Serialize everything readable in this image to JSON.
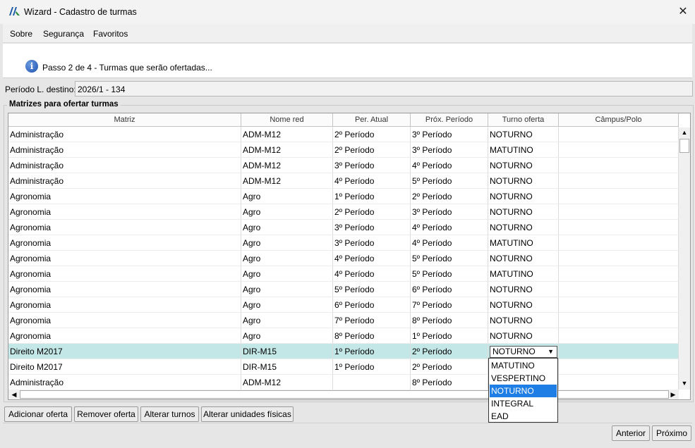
{
  "window": {
    "title": "Wizard - Cadastro de turmas",
    "close_glyph": "✕"
  },
  "menu": [
    {
      "label": "Sobre"
    },
    {
      "label": "Segurança"
    },
    {
      "label": "Favoritos"
    }
  ],
  "header": {
    "step_text": "Passo 2 de 4 - Turmas que serão ofertadas..."
  },
  "periodo": {
    "label": "Período L. destino:",
    "value": "2026/1 - 134"
  },
  "group": {
    "title": "Matrizes para ofertar turmas"
  },
  "table": {
    "columns": [
      "Matriz",
      "Nome red",
      "Per. Atual",
      "Próx. Período",
      "Turno oferta",
      "Câmpus/Polo"
    ],
    "rows": [
      [
        "Administração",
        "ADM-M12",
        "2º Período",
        "3º Período",
        "NOTURNO",
        ""
      ],
      [
        "Administração",
        "ADM-M12",
        "2º Período",
        "3º Período",
        "MATUTINO",
        ""
      ],
      [
        "Administração",
        "ADM-M12",
        "3º Período",
        "4º Período",
        "NOTURNO",
        ""
      ],
      [
        "Administração",
        "ADM-M12",
        "4º Período",
        "5º Período",
        "NOTURNO",
        ""
      ],
      [
        "Agronomia",
        "Agro",
        "1º Período",
        "2º Período",
        "NOTURNO",
        ""
      ],
      [
        "Agronomia",
        "Agro",
        "2º Período",
        "3º Período",
        "NOTURNO",
        ""
      ],
      [
        "Agronomia",
        "Agro",
        "3º Período",
        "4º Período",
        "NOTURNO",
        ""
      ],
      [
        "Agronomia",
        "Agro",
        "3º Período",
        "4º Período",
        "MATUTINO",
        ""
      ],
      [
        "Agronomia",
        "Agro",
        "4º Período",
        "5º Período",
        "NOTURNO",
        ""
      ],
      [
        "Agronomia",
        "Agro",
        "4º Período",
        "5º Período",
        "MATUTINO",
        ""
      ],
      [
        "Agronomia",
        "Agro",
        "5º Período",
        "6º Período",
        "NOTURNO",
        ""
      ],
      [
        "Agronomia",
        "Agro",
        "6º Período",
        "7º Período",
        "NOTURNO",
        ""
      ],
      [
        "Agronomia",
        "Agro",
        "7º Período",
        "8º Período",
        "NOTURNO",
        ""
      ],
      [
        "Agronomia",
        "Agro",
        "8º Período",
        "1º Período",
        "NOTURNO",
        ""
      ],
      [
        "Direito M2017",
        "DIR-M15",
        "1º Período",
        "2º Período",
        "NOTURNO",
        ""
      ],
      [
        "Direito M2017",
        "DIR-M15",
        "1º Período",
        "2º Período",
        "",
        ""
      ],
      [
        "Administração",
        "ADM-M12",
        "",
        "8º Período",
        "",
        ""
      ]
    ],
    "selected_row": 14
  },
  "turno_select": {
    "value": "NOTURNO",
    "options": [
      "MATUTINO",
      "VESPERTINO",
      "NOTURNO",
      "INTEGRAL",
      "EAD"
    ],
    "highlighted": "NOTURNO"
  },
  "actions": {
    "adicionar": "Adicionar oferta",
    "remover": "Remover oferta",
    "alterar_turnos": "Alterar turnos",
    "alterar_unidades": "Alterar unidades físicas"
  },
  "nav": {
    "anterior": "Anterior",
    "proximo": "Próximo"
  },
  "icons": {
    "info": "info-icon",
    "logo": "app-logo-icon",
    "close": "close-icon"
  },
  "colors": {
    "selected_row": "#c3e6e6",
    "highlight": "#1e7ee6"
  }
}
